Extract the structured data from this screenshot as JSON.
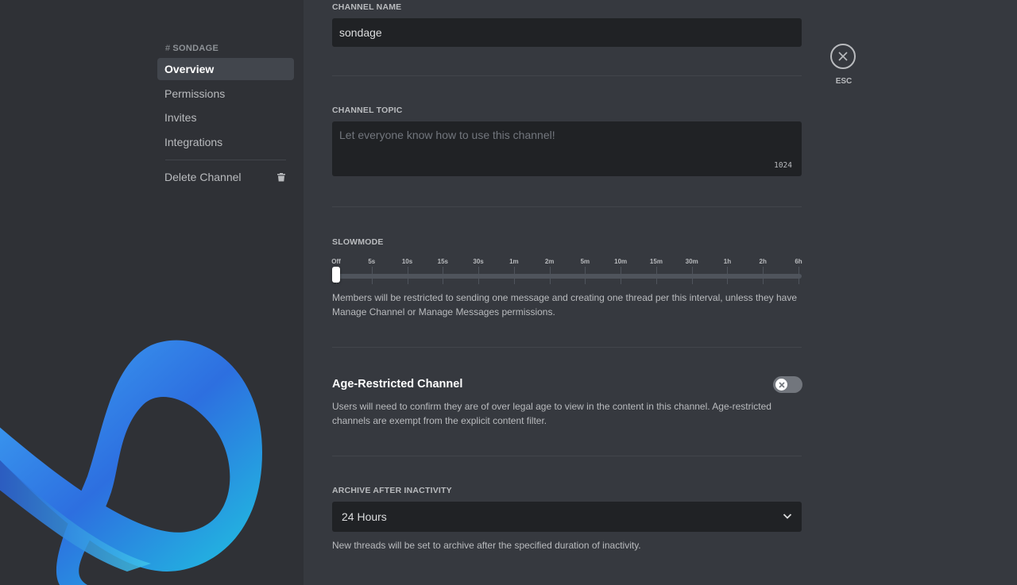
{
  "sidebar": {
    "channel_name": "SONDAGE",
    "items": [
      {
        "label": "Overview"
      },
      {
        "label": "Permissions"
      },
      {
        "label": "Invites"
      },
      {
        "label": "Integrations"
      }
    ],
    "delete_label": "Delete Channel"
  },
  "close": {
    "label": "ESC"
  },
  "channel_name": {
    "title": "CHANNEL NAME",
    "value": "sondage"
  },
  "channel_topic": {
    "title": "CHANNEL TOPIC",
    "placeholder": "Let everyone know how to use this channel!",
    "counter": "1024"
  },
  "slowmode": {
    "title": "SLOWMODE",
    "ticks": [
      "Off",
      "5s",
      "10s",
      "15s",
      "30s",
      "1m",
      "2m",
      "5m",
      "10m",
      "15m",
      "30m",
      "1h",
      "2h",
      "6h"
    ],
    "selected": "Off",
    "help": "Members will be restricted to sending one message and creating one thread per this interval, unless they have Manage Channel or Manage Messages permissions."
  },
  "age_restricted": {
    "title": "Age-Restricted Channel",
    "enabled": false,
    "help": "Users will need to confirm they are of over legal age to view in the content in this channel. Age-restricted channels are exempt from the explicit content filter."
  },
  "archive": {
    "title": "ARCHIVE AFTER INACTIVITY",
    "selected": "24 Hours",
    "help": "New threads will be set to archive after the specified duration of inactivity."
  },
  "colors": {
    "accent": "#5865f2",
    "background": "#36393f",
    "sidebar": "#2f3136",
    "input": "#202225"
  }
}
